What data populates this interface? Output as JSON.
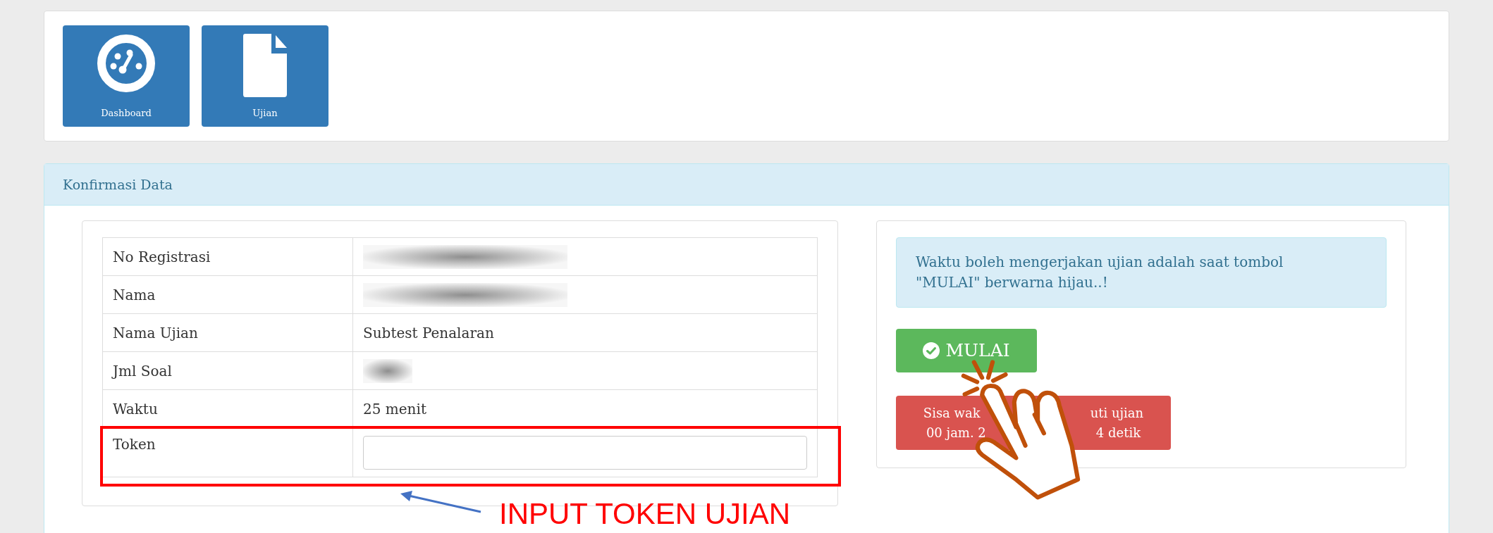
{
  "nav": [
    {
      "label": "Dashboard",
      "kind": "dashboard"
    },
    {
      "label": "Ujian",
      "kind": "document"
    }
  ],
  "panel": {
    "title": "Konfirmasi Data"
  },
  "table": {
    "rows": [
      {
        "label": "No Registrasi",
        "kind": "blurred"
      },
      {
        "label": "Nama",
        "kind": "blurred"
      },
      {
        "label": "Nama Ujian",
        "kind": "text",
        "value": "Subtest Penalaran"
      },
      {
        "label": "Jml Soal",
        "kind": "blurred_short"
      },
      {
        "label": "Waktu",
        "kind": "text",
        "value": "25 menit"
      },
      {
        "label": "Token",
        "kind": "input"
      }
    ]
  },
  "notice": "Waktu boleh mengerjakan ujian adalah saat tombol \"MULAI\" berwarna hijau..!",
  "start_button": {
    "label": "MULAI"
  },
  "countdown": {
    "lines": [
      [
        "Sisa wak",
        "uti ujian"
      ],
      [
        "00 jam. 2",
        "4 detik"
      ]
    ]
  },
  "annotation": {
    "label": "INPUT TOKEN UJIAN"
  }
}
